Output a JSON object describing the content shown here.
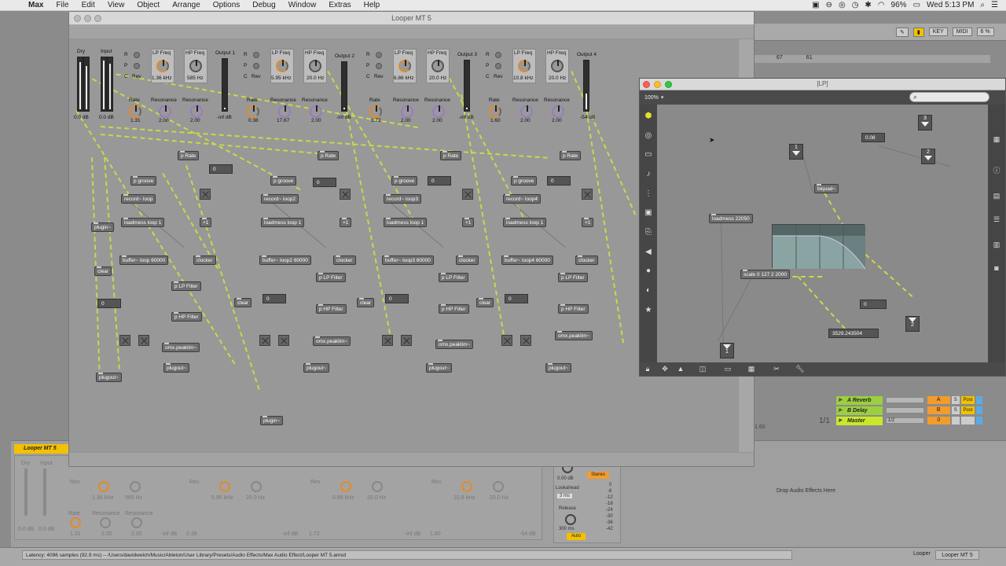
{
  "menubar": {
    "app": "Max",
    "items": [
      "File",
      "Edit",
      "View",
      "Object",
      "Arrange",
      "Options",
      "Debug",
      "Window",
      "Extras",
      "Help"
    ],
    "battery": "96%",
    "clock": "Wed 5:13 PM"
  },
  "live": {
    "key_label": "KEY",
    "midi_label": "MIDI",
    "cpu": "6 %",
    "ruler": [
      "67",
      "61"
    ],
    "returns": [
      {
        "name": "A Reverb",
        "badge": "A",
        "s": "S",
        "post": "Post"
      },
      {
        "name": "B Delay",
        "badge": "B",
        "s": "S",
        "post": "Post"
      },
      {
        "name": "Master",
        "badge": "0",
        "s": "",
        "post": "",
        "routing": "1/2"
      }
    ],
    "fraction": "1/1",
    "timeline": "1.60"
  },
  "device": {
    "title": "Looper MT 5",
    "labels": {
      "dry": "Dry",
      "input": "Input",
      "rev": "Rev",
      "freq1": "1.36 kHz",
      "freq2": "585 Hz",
      "freq3": "5.95 kHz",
      "freq4": "20.0 Hz",
      "freq5": "6.86 kHz",
      "freq6": "20.0 Hz",
      "freq7": "10.8 kHz",
      "freq8": "20.0 Hz",
      "rate": "Rate",
      "resonance": "Resonance",
      "db0": "0.0 dB",
      "neg_inf": "-inf dB",
      "neg54": "-54 dB",
      "rate1": "1.31",
      "rate2": "0.38",
      "rate3": "1.72",
      "rate4": "1.60",
      "res": "2.00"
    },
    "limiter": {
      "stereo": "Stereo",
      "db": "0.00 dB",
      "lookahead": "Lookahead",
      "lookahead_val": "3 ms",
      "release": "Release",
      "release_val": "300 ms",
      "auto": "Auto",
      "scale": [
        "0",
        "-6",
        "-12",
        "-18",
        "-24",
        "-30",
        "-36",
        "-42"
      ]
    },
    "drop_text": "Drop Audio Effects Here"
  },
  "status": {
    "path": "Latency: 4096 samples (92.9 ms) -- /Users/davidwelch/Music/Ableton/User Library/Presets/Audio Effects/Max Audio Effect/Looper MT 5.amxd",
    "right_label": "Looper",
    "right_value": "Looper MT 5"
  },
  "looper": {
    "title": "Looper MT 5",
    "top_labels": {
      "dry": "Dry",
      "input": "Input",
      "r": "R",
      "p": "P",
      "c": "C",
      "rev": "Rev",
      "lp_freq": "LP Freq",
      "hp_freq": "HP Freq",
      "rate": "Rate",
      "resonance": "Resonance",
      "out1": "Output 1",
      "out2": "Output 2",
      "out3": "Output 3",
      "out4": "Output 4",
      "f1": "1.36 kHz",
      "f2": "585 Hz",
      "f3": "5.95 kHz",
      "f4": "20.0 Hz",
      "f5": "6.86 kHz",
      "f6": "20.0 Hz",
      "f7": "10.8 kHz",
      "f8": "20.0 Hz",
      "db0": "0.0 dB",
      "db0b": "0.0 dB",
      "ninf": "-inf dB",
      "n54": "-54 dB",
      "r1": "1.31",
      "r2": "0.38",
      "r3": "1.72",
      "r4": "1.60",
      "res_a": "2.00",
      "res_b": "2.00",
      "res_c": "17.67",
      "res_d": "2.00",
      "res_e": "2.00",
      "res_f": "2.00",
      "res_g": "2.00",
      "res_h": "2.00"
    },
    "objects": {
      "prate": "p Rate",
      "pgroove": "p groove",
      "rec1": "record~ loop",
      "rec2": "record~ loop2",
      "rec3": "record~ loop3",
      "rec4": "record~ loop4",
      "loadmess1": "loadmess loop 1",
      "buf1": "buffer~ loop 60000",
      "buf2": "buffer~ loop2 60000",
      "buf3": "buffer~ loop3 60000",
      "buf4": "buffer~ loop4 60000",
      "clocker": "clocker",
      "plus1": "+1",
      "plpfilter": "p LP Filter",
      "phpfilter": "p HP Filter",
      "peaklim": "omx.peaklim~",
      "plugout": "plugout~",
      "plugin": "plugin~",
      "clear": "clear",
      "zero": "0"
    }
  },
  "lp": {
    "title": "[LP]",
    "zoom": "100%",
    "objects": {
      "loadmess": "loadmess 22050",
      "biquad": "biquad~",
      "scale": "scale 0 127 2 2000",
      "float_val": "0.08",
      "zero": "0",
      "freq_out": "3529.243504"
    },
    "inlets": [
      "1",
      "2",
      "3"
    ],
    "outlets": [
      "1",
      "2"
    ]
  }
}
